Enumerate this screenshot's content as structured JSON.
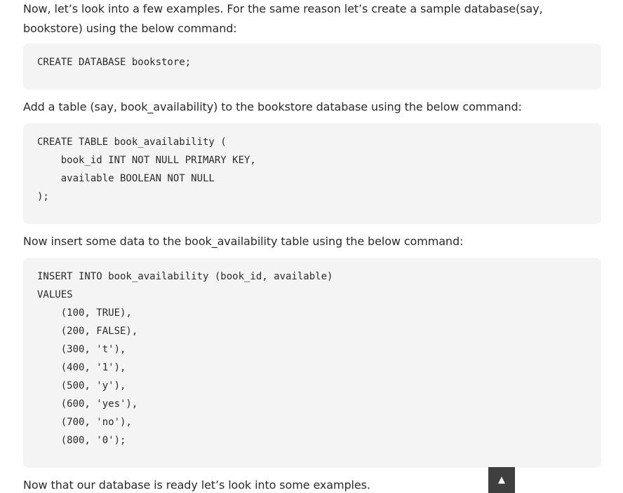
{
  "paragraphs": {
    "intro": "Now, let’s look into a few examples. For the same reason let’s create a sample database(say, bookstore) using the below command:",
    "add_table": "Add a table (say, book_availability) to the bookstore database using the below command:",
    "insert_data": "Now insert some data to the book_availability table using the below command:",
    "ready": "Now that our database is ready let’s look into some examples."
  },
  "code_blocks": {
    "create_db": {
      "lines": [
        "CREATE DATABASE bookstore;"
      ]
    },
    "create_table": {
      "lines": [
        "CREATE TABLE book_availability (",
        "    book_id INT NOT NULL PRIMARY KEY,",
        "    available BOOLEAN NOT NULL",
        ");"
      ]
    },
    "insert": {
      "lines": [
        "INSERT INTO book_availability (book_id, available)",
        "VALUES",
        "    (100, TRUE),",
        "    (200, FALSE),",
        "    (300, 't'),",
        "    (400, '1'),",
        "    (500, 'y'),",
        "    (600, 'yes'),",
        "    (700, 'no'),",
        "    (800, '0');"
      ]
    }
  },
  "scroll_top": {
    "icon": "▲",
    "icon_name": "arrow-up-icon"
  }
}
